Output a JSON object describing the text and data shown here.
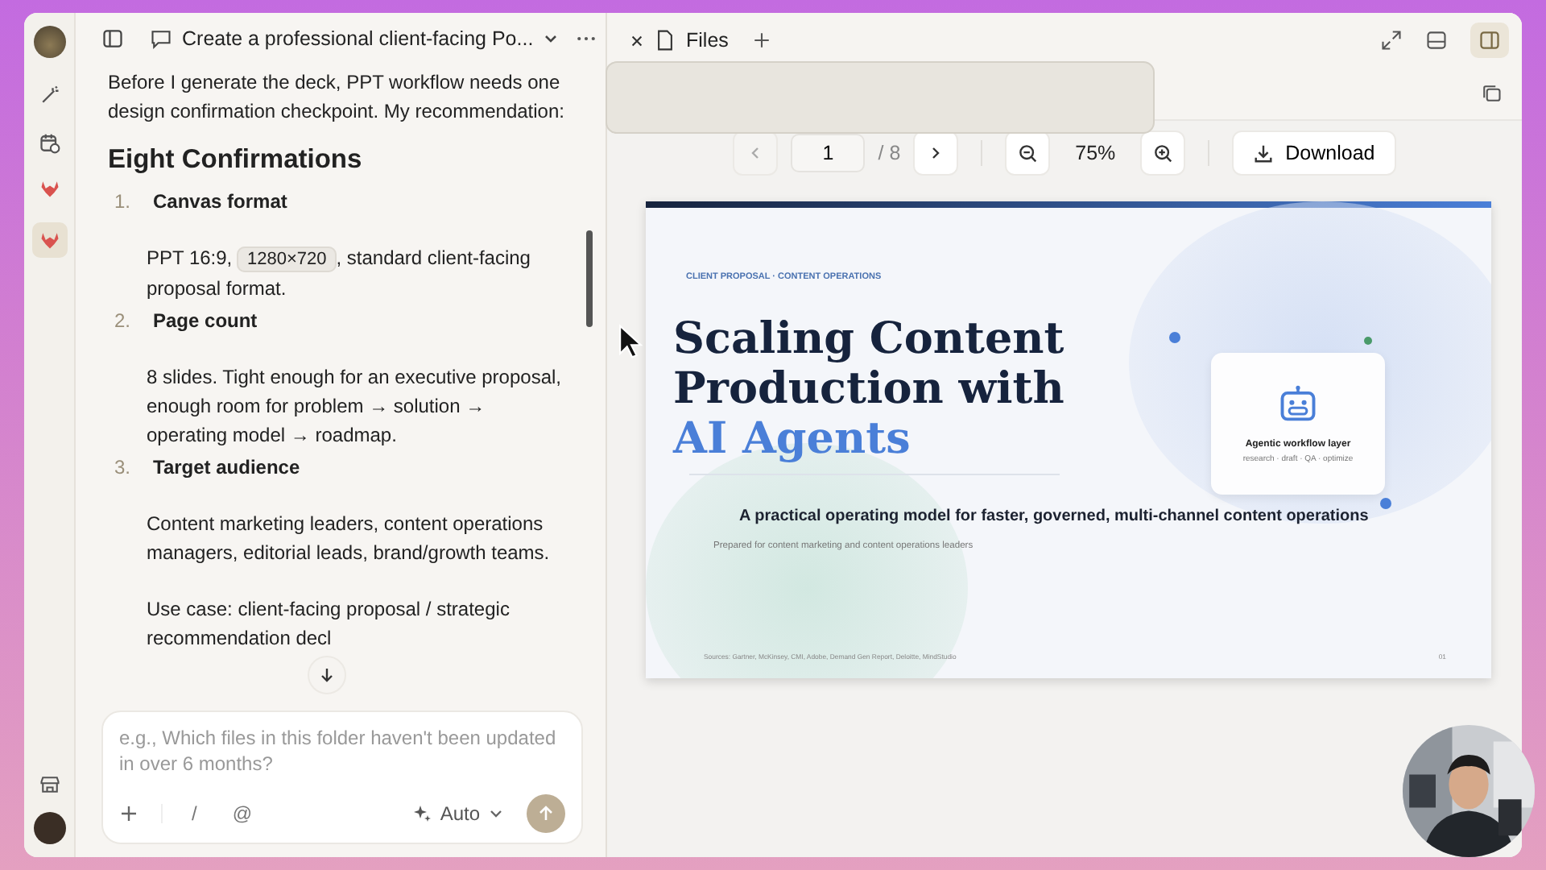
{
  "rail": {
    "apps": [
      {
        "selected": false
      },
      {
        "selected": true
      }
    ]
  },
  "chat": {
    "title": "Create a professional client-facing Po...",
    "intro": "Before I generate the deck, PPT workflow needs one design confirmation checkpoint. My recommendation:",
    "heading": "Eight Confirmations",
    "items": [
      {
        "number": "1.",
        "title": "Canvas format",
        "paragraphs": [
          [
            {
              "kind": "text",
              "text": "PPT 16:9, "
            },
            {
              "kind": "code",
              "text": "1280×720"
            },
            {
              "kind": "text",
              "text": ", standard client-facing proposal format."
            }
          ]
        ]
      },
      {
        "number": "2.",
        "title": "Page count",
        "paragraphs": [
          [
            {
              "kind": "text",
              "text": "8 slides. Tight enough for an executive proposal, enough room for problem → solution → operating model → roadmap."
            }
          ]
        ]
      },
      {
        "number": "3.",
        "title": "Target audience",
        "paragraphs": [
          [
            {
              "kind": "text",
              "text": "Content marketing leaders, content operations managers, editorial leads, brand/growth teams."
            }
          ],
          [
            {
              "kind": "text",
              "text": "Use case: client-facing proposal / strategic recommendation decl"
            }
          ]
        ]
      }
    ],
    "input": {
      "placeholder": "e.g., Which files in this folder haven't been updated in over 6 months?",
      "slash": "/",
      "at": "@",
      "mode": "Auto"
    }
  },
  "viewer": {
    "tab": "Files",
    "page": "1",
    "total": "/ 8",
    "zoom": "75%",
    "download": "Download",
    "slide": {
      "eyebrow": "CLIENT PROPOSAL · CONTENT OPERATIONS",
      "title_lines": [
        "Scaling Content",
        "Production with"
      ],
      "title_accent": "AI Agents",
      "subtitle": "A practical operating model for faster, governed, multi-channel content operations",
      "prepared": "Prepared for content marketing and content operations leaders",
      "card_title": "Agentic workflow layer",
      "card_sub": "research · draft · QA · optimize",
      "sources": "Sources: Gartner, McKinsey, CMI, Adobe, Demand Gen Report, Deloitte, MindStudio",
      "page_number": "01"
    }
  }
}
